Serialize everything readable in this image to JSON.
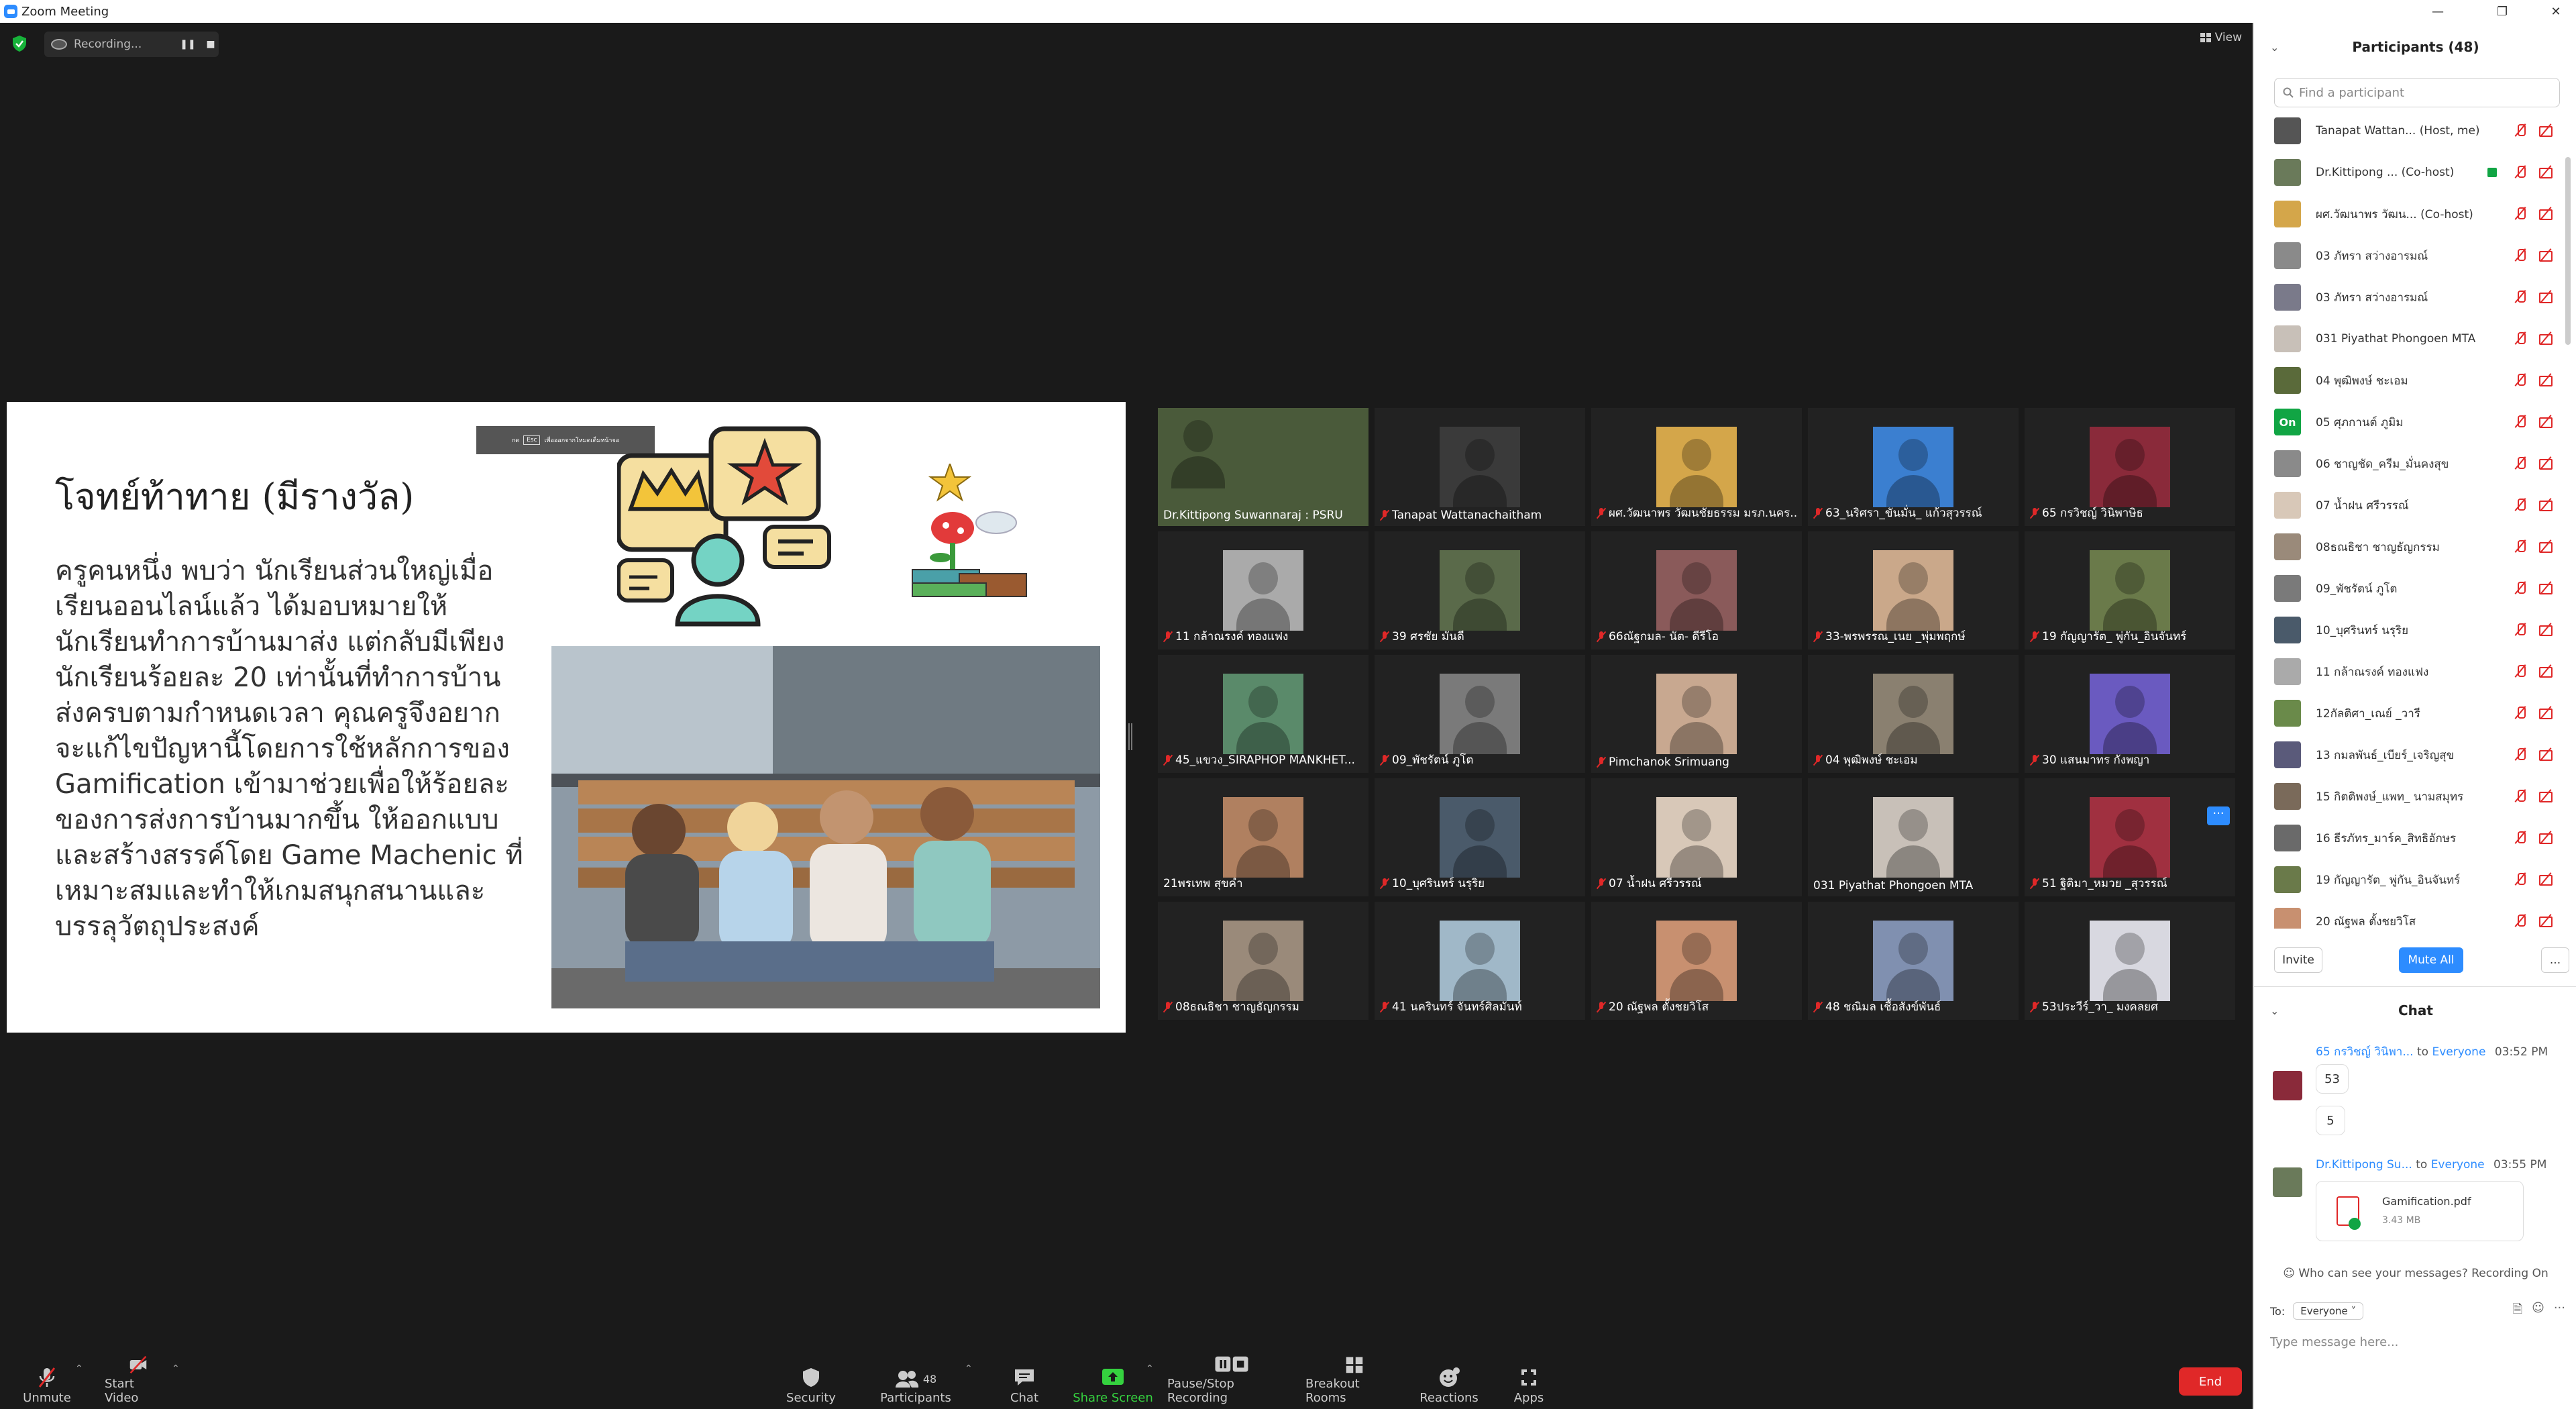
{
  "window": {
    "title": "Zoom Meeting"
  },
  "top": {
    "recording_label": "Recording...",
    "view_label": "View"
  },
  "slide": {
    "title": "โจทย์ท้าทาย (มีรางวัล)",
    "body": "   ครูคนหนึ่ง พบว่า นักเรียนส่วนใหญ่เมื่อ\nเรียนออนไลน์แล้ว ได้มอบหมายให้\nนักเรียนทำการบ้านมาส่ง แต่กลับมีเพียง\nนักเรียนร้อยละ 20 เท่านั้นที่ทำการบ้าน\nส่งครบตามกำหนดเวลา คุณครูจึงอยากจะแก้ไขปัญหานี้โดยการใช้หลักการของ\nGamification เข้ามาช่วยเพื่อให้ร้อยละ\nของการส่งการบ้านมากขึ้น ให้ออกแบบ\nและสร้างสรรค์โดย Game Machenic ที่\nเหมาะสมและทำให้เกมสนุกสนานและ\nบรรลุวัตถุประสงค์",
    "esc_prefix": "กด",
    "esc_key": "Esc",
    "esc_hint": "เพื่อออกจากโหมดเต็มหน้าจอ"
  },
  "tiles": [
    {
      "name": "Dr.Kittipong Suwannaraj : PSRU",
      "muted": false,
      "active": true,
      "color": "#4a5a3a"
    },
    {
      "name": "Tanapat Wattanachaitham",
      "muted": true,
      "active": false,
      "color": "#3a3a3a"
    },
    {
      "name": "ผศ.วัฒนาพร วัฒนชัยธรรม มรภ.นคร...",
      "muted": true,
      "active": false,
      "color": "#d4a64a"
    },
    {
      "name": "63_นริศรา_ขันมั่น_ แก้วสุวรรณ์",
      "muted": true,
      "active": false,
      "color": "#3b7fd0"
    },
    {
      "name": "65 กรวิชญ์ วินิพาษิธ",
      "muted": true,
      "active": false,
      "color": "#8a2a3a"
    },
    {
      "name": "11 กล้าณรงค์ ทองแฟง",
      "muted": true,
      "active": false,
      "color": "#aaaaaa"
    },
    {
      "name": "39 ศรชัย มันดี",
      "muted": true,
      "active": false,
      "color": "#5a6a4a"
    },
    {
      "name": "66ณัฐกมล- นัต- ดีรีโอ",
      "muted": true,
      "active": false,
      "color": "#8a5a5a"
    },
    {
      "name": "33-พรพรรณ_เนย _พุ่มพฤกษ์",
      "muted": true,
      "active": false,
      "color": "#caa88a"
    },
    {
      "name": "19 กัญญารัต_ พู่กัน_อินจันทร์",
      "muted": true,
      "active": false,
      "color": "#6a7a4a"
    },
    {
      "name": "45_แขวง_SIRAPHOP MANKHET...",
      "muted": true,
      "active": false,
      "color": "#5a8a6a"
    },
    {
      "name": "09_พัชรัตน์ ภูโต",
      "muted": true,
      "active": false,
      "color": "#7a7a7a"
    },
    {
      "name": "Pimchanok Srimuang",
      "muted": true,
      "active": false,
      "color": "#c8a890"
    },
    {
      "name": "04 พุฒิพงษ์ ชะเอม",
      "muted": true,
      "active": false,
      "color": "#8a8070"
    },
    {
      "name": "30 แสนมาทร กังพญา",
      "muted": true,
      "active": false,
      "color": "#6a5ac0"
    },
    {
      "name": "21พรเทพ สุขคำ",
      "muted": false,
      "active": false,
      "color": "#b08060"
    },
    {
      "name": "10_บุศรินทร์ นรุริย",
      "muted": true,
      "active": false,
      "color": "#4a5a6a"
    },
    {
      "name": "07 น้ำฝน ศรีวรรณ์",
      "muted": true,
      "active": false,
      "color": "#d8c8b8"
    },
    {
      "name": "031 Piyathat Phongoen MTA",
      "muted": false,
      "active": false,
      "color": "#c8c0b8"
    },
    {
      "name": "51 ฐิติมา_หมวย _สุวรรณ์",
      "muted": true,
      "active": false,
      "color": "#a03040"
    },
    {
      "name": "08ธณธิชา ชาญธัญกรรม",
      "muted": true,
      "active": false,
      "color": "#9a8a7a"
    },
    {
      "name": "41 นครินทร์ จันทร์ศิลมันท์",
      "muted": true,
      "active": false,
      "color": "#a0b8c8"
    },
    {
      "name": "20 ณัฐพล ตั้งชยวิโส",
      "muted": true,
      "active": false,
      "color": "#c89070"
    },
    {
      "name": "48 ชณิมล เชื้อสังข์พันธ์",
      "muted": true,
      "active": false,
      "color": "#8090b0"
    },
    {
      "name": "53ประวีร์_วา_ มงคลยศ",
      "muted": true,
      "active": false,
      "color": "#d8d8e0"
    }
  ],
  "toolbar": {
    "unmute": "Unmute",
    "start_video": "Start Video",
    "security": "Security",
    "participants": "Participants",
    "participants_count": "48",
    "chat": "Chat",
    "share_screen": "Share Screen",
    "pause_recording": "Pause/Stop Recording",
    "breakout": "Breakout Rooms",
    "reactions": "Reactions",
    "apps": "Apps",
    "end": "End"
  },
  "participants_panel": {
    "title": "Participants (48)",
    "search_placeholder": "Find a participant",
    "invite": "Invite",
    "mute_all": "Mute All",
    "more": "...",
    "rows": [
      {
        "name": "Tanapat Wattan...",
        "role": "(Host, me)",
        "color": "#555555"
      },
      {
        "name": "Dr.Kittipong ...",
        "role": "(Co-host)",
        "color": "#6a7a5a"
      },
      {
        "name": "ผศ.วัฒนาพร วัฒน...",
        "role": "(Co-host)",
        "color": "#d4a64a"
      },
      {
        "name": "03 ภัทรา สว่างอารมณ์",
        "role": "",
        "color": "#8a8a8a"
      },
      {
        "name": "03 ภัทรา สว่างอารมณ์",
        "role": "",
        "color": "#7a7a8a"
      },
      {
        "name": "031 Piyathat Phongoen MTA",
        "role": "",
        "color": "#c8c0b8"
      },
      {
        "name": "04 พุฒิพงษ์ ชะเอม",
        "role": "",
        "color": "#5a6a3a"
      },
      {
        "name": "05 ศุภกานต์ ภูมิม",
        "role": "",
        "color": "#11a544"
      },
      {
        "name": "06 ชาญชัด_ครีม_มั่นคงสุข",
        "role": "",
        "color": "#8a8a8a"
      },
      {
        "name": "07 น้ำฝน ศรีวรรณ์",
        "role": "",
        "color": "#d8c8b8"
      },
      {
        "name": "08ธณธิชา ชาญธัญกรรม",
        "role": "",
        "color": "#9a8a7a"
      },
      {
        "name": "09_พัชรัตน์ ภูโต",
        "role": "",
        "color": "#7a7a7a"
      },
      {
        "name": "10_บุศรินทร์ นรุริย",
        "role": "",
        "color": "#4a5a6a"
      },
      {
        "name": "11 กล้าณรงค์ ทองแฟง",
        "role": "",
        "color": "#aaaaaa"
      },
      {
        "name": "12กัลติศา_เณย์ _วารี",
        "role": "",
        "color": "#6a8a4a"
      },
      {
        "name": "13 กมลพันธ์_เบียร์_เจริญสุข",
        "role": "",
        "color": "#5a5a7a"
      },
      {
        "name": "15 กิตติพงษ์_แพท_ นามสมุทร",
        "role": "",
        "color": "#7a6a5a"
      },
      {
        "name": "16 ธีรภัทร_มาร์ค_สิทธิอักษร",
        "role": "",
        "color": "#6a6a6a"
      },
      {
        "name": "19 กัญญารัต_ พู่กัน_อินจันทร์",
        "role": "",
        "color": "#6a7a4a"
      },
      {
        "name": "20 ณัฐพล ตั้งชยวิโส",
        "role": "",
        "color": "#c89070"
      }
    ],
    "on_badge": "On"
  },
  "chat": {
    "title": "Chat",
    "messages": [
      {
        "sender": "65 กรวิชญ์ วินิพา...",
        "to_label": "to",
        "recipient": "Everyone",
        "time": "03:52 PM",
        "bubbles": [
          "53",
          "5"
        ]
      },
      {
        "sender": "Dr.Kittipong Su...",
        "to_label": "to",
        "recipient": "Everyone",
        "time": "03:55 PM",
        "file_name": "Gamification.pdf",
        "file_size": "3.43 MB"
      }
    ],
    "who_can_see": "Who can see your messages? Recording On",
    "to_label": "To:",
    "to_value": "Everyone",
    "input_placeholder": "Type message here..."
  }
}
